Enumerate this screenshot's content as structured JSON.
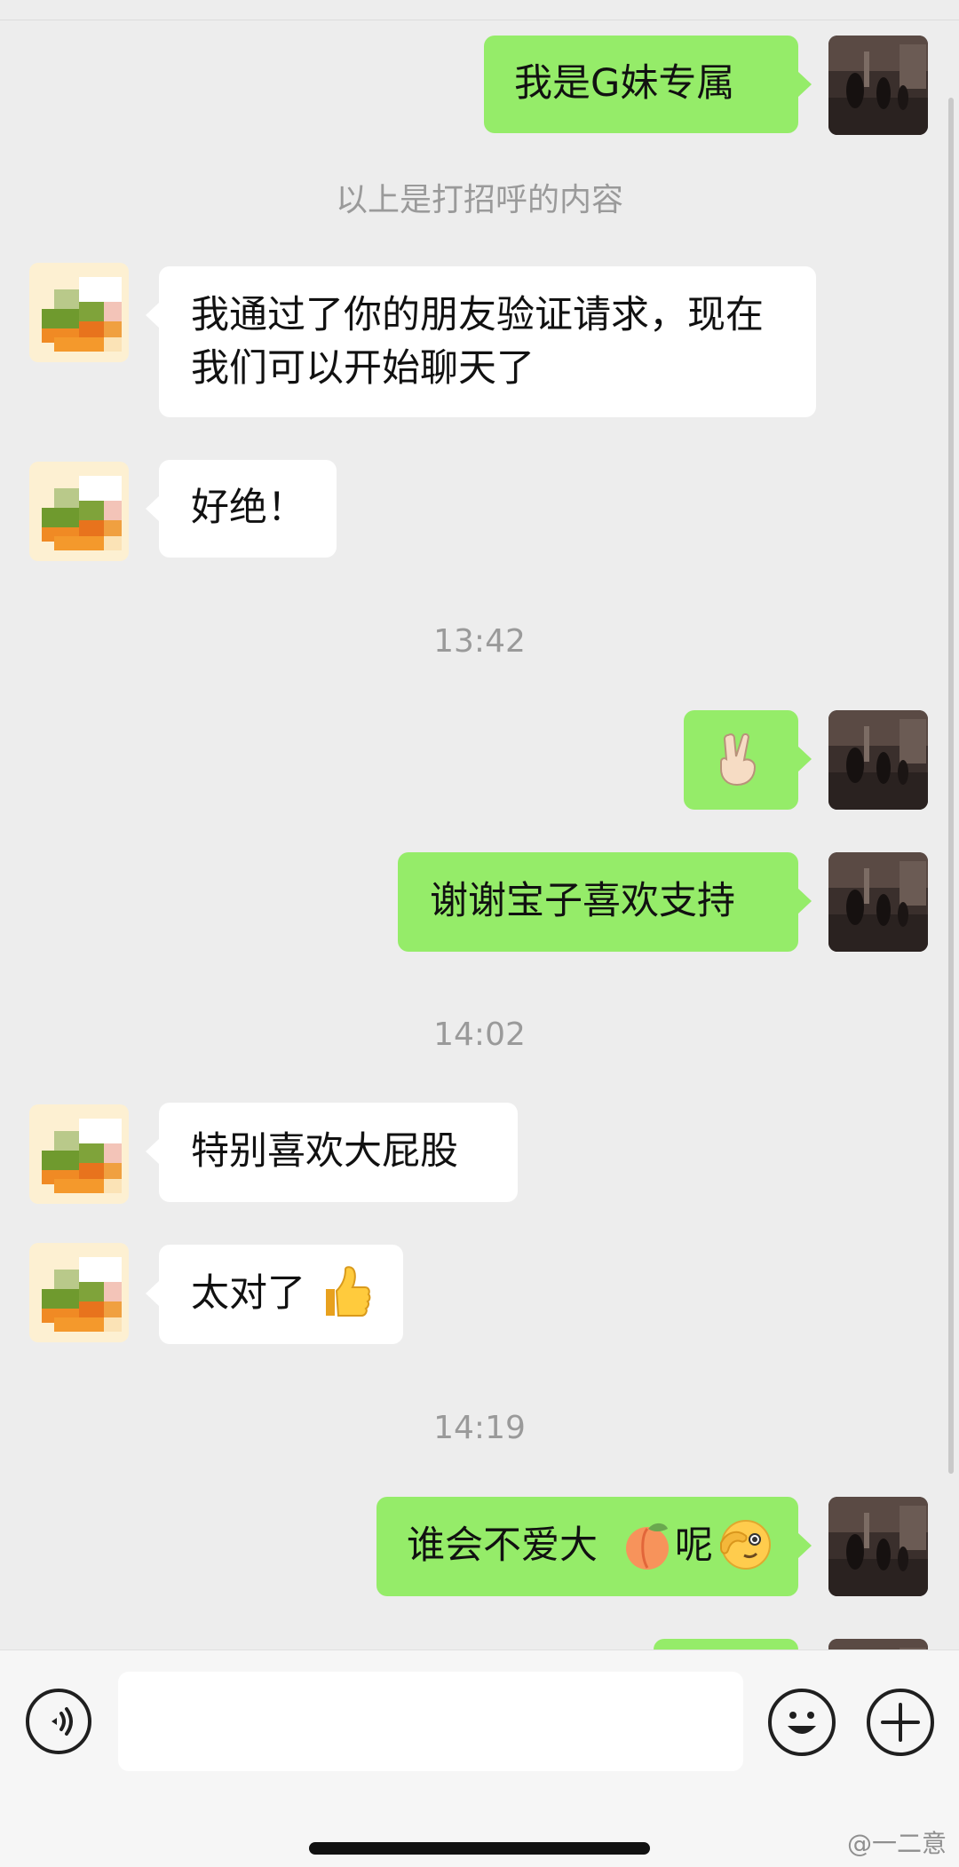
{
  "messages": {
    "m1": "我是G妹专属",
    "m2": "我通过了你的朋友验证请求，现在我们可以开始聊天了",
    "m3": "好绝！",
    "m4_emoji": "victory-hand-emoji",
    "m5": "谢谢宝子喜欢支持",
    "m6": "特别喜欢大屁股",
    "m7": "太对了",
    "m7_emoji": "thumbs-up-emoji",
    "m8_part1": "谁会不爱大",
    "m8_emoji1": "peach-emoji",
    "m8_part2": "呢",
    "m8_emoji2": "face-with-hand-over-eye-emoji"
  },
  "system": {
    "greeting_note": "以上是打招呼的内容",
    "time1": "13:42",
    "time2": "14:02",
    "time3": "14:19"
  },
  "composer": {
    "voice_icon": "voice-icon",
    "emoji_icon": "smiley-icon",
    "plus_icon": "plus-icon",
    "input_value": ""
  },
  "watermark": "@一二意",
  "colors": {
    "outgoing_bubble": "#95ec69",
    "incoming_bubble": "#ffffff",
    "background": "#ededed",
    "system_text": "#9a9a9a"
  }
}
